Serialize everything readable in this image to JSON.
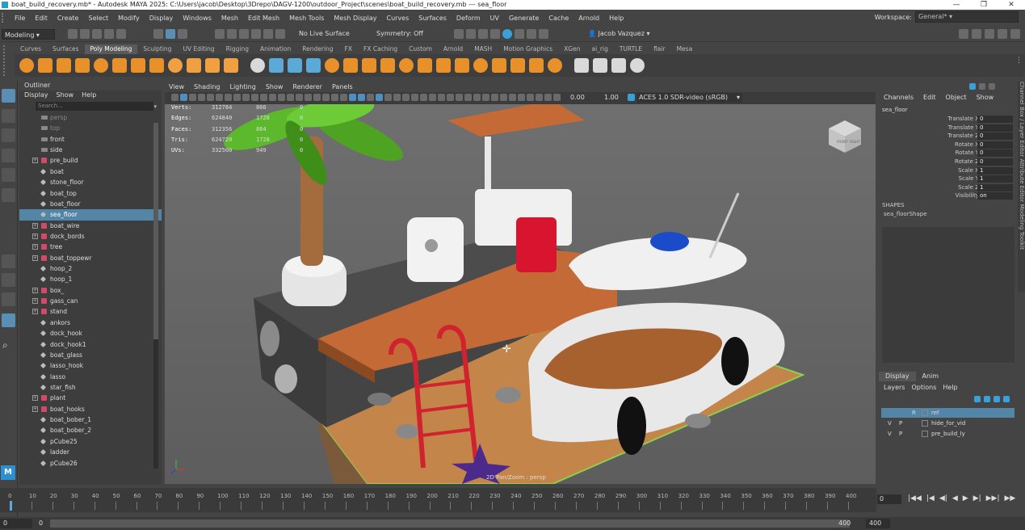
{
  "window": {
    "title": "boat_build_recovery.mb* - Autodesk MAYA 2025: C:\\Users\\jacob\\Desktop\\3Drepo\\DAGV-1200\\outdoor_Project\\scenes\\boat_build_recovery.mb   ---   sea_floor",
    "controls": [
      "—",
      "❐",
      "✕"
    ]
  },
  "menubar": {
    "items": [
      "File",
      "Edit",
      "Create",
      "Select",
      "Modify",
      "Display",
      "Windows",
      "Mesh",
      "Edit Mesh",
      "Mesh Tools",
      "Mesh Display",
      "Curves",
      "Surfaces",
      "Deform",
      "UV",
      "Generate",
      "Cache",
      "Arnold",
      "Help"
    ],
    "workspace_label": "Workspace:",
    "workspace_value": "General*"
  },
  "statusline": {
    "mode": "Modeling",
    "live_surface": "No Live Surface",
    "symmetry": "Symmetry: Off",
    "user": "Jacob Vazquez"
  },
  "shelf": {
    "tabs": [
      "Curves",
      "Surfaces",
      "Poly Modeling",
      "Sculpting",
      "UV Editing",
      "Rigging",
      "Animation",
      "Rendering",
      "FX",
      "FX Caching",
      "Custom",
      "Arnold",
      "MASH",
      "Motion Graphics",
      "XGen",
      "ai_rig",
      "TURTLE",
      "flair",
      "Mesa"
    ],
    "active_tab": "Poly Modeling",
    "icon_colors": [
      "#e8912a",
      "#e8912a",
      "#e8912a",
      "#e8912a",
      "#e8912a",
      "#e8912a",
      "#e8912a",
      "#e8912a",
      "#f0a040",
      "#f0a040",
      "#f0a040",
      "#f0a040",
      "#d9d9d9",
      "#5aa9d6",
      "#5aa9d6",
      "#5aa9d6",
      "#e8912a",
      "#e8912a",
      "#e8912a",
      "#e8912a",
      "#e8912a",
      "#e8912a",
      "#e8912a",
      "#e8912a",
      "#e8912a",
      "#e8912a",
      "#e8912a",
      "#e8912a",
      "#e8912a",
      "#d9d9d9",
      "#d9d9d9",
      "#d9d9d9",
      "#d9d9d9"
    ]
  },
  "outliner": {
    "title": "Outliner",
    "menus": [
      "Display",
      "Show",
      "Help"
    ],
    "search_placeholder": "Search...",
    "items": [
      {
        "label": "persp",
        "type": "cam",
        "dim": true
      },
      {
        "label": "top",
        "type": "cam",
        "dim": true
      },
      {
        "label": "front",
        "type": "cam"
      },
      {
        "label": "side",
        "type": "cam"
      },
      {
        "label": "pre_build",
        "type": "grp",
        "expand": true
      },
      {
        "label": "boat",
        "type": "mesh"
      },
      {
        "label": "stone_floor",
        "type": "mesh"
      },
      {
        "label": "boat_top",
        "type": "mesh"
      },
      {
        "label": "boat_floor",
        "type": "mesh"
      },
      {
        "label": "sea_floor",
        "type": "mesh",
        "selected": true
      },
      {
        "label": "boat_wire",
        "type": "grp",
        "expand": true
      },
      {
        "label": "dock_bords",
        "type": "grp",
        "expand": true
      },
      {
        "label": "tree",
        "type": "grp",
        "expand": true
      },
      {
        "label": "boat_toppewr",
        "type": "grp",
        "expand": true
      },
      {
        "label": "hoop_2",
        "type": "mesh"
      },
      {
        "label": "hoop_1",
        "type": "mesh"
      },
      {
        "label": "box_",
        "type": "grp",
        "expand": true
      },
      {
        "label": "gass_can",
        "type": "grp",
        "expand": true
      },
      {
        "label": "stand",
        "type": "grp",
        "expand": true
      },
      {
        "label": "ankors",
        "type": "mesh"
      },
      {
        "label": "dock_hook",
        "type": "mesh"
      },
      {
        "label": "dock_hook1",
        "type": "mesh"
      },
      {
        "label": "boat_glass",
        "type": "mesh"
      },
      {
        "label": "lasso_hook",
        "type": "mesh"
      },
      {
        "label": "lasso",
        "type": "mesh"
      },
      {
        "label": "star_fish",
        "type": "mesh"
      },
      {
        "label": "plant",
        "type": "grp",
        "expand": true
      },
      {
        "label": "boat_hooks",
        "type": "grp",
        "expand": true
      },
      {
        "label": "boat_bober_1",
        "type": "mesh"
      },
      {
        "label": "boat_bober_2",
        "type": "mesh"
      },
      {
        "label": "pCube25",
        "type": "mesh"
      },
      {
        "label": "ladder",
        "type": "mesh"
      },
      {
        "label": "pCube26",
        "type": "mesh"
      }
    ]
  },
  "viewport": {
    "menus": [
      "View",
      "Shading",
      "Lighting",
      "Show",
      "Renderer",
      "Panels"
    ],
    "field_a": "0.00",
    "field_b": "1.00",
    "colorspace": "ACES 1.0 SDR-video (sRGB)",
    "camera_label": "2D Pan/Zoom : persp",
    "hud": [
      {
        "label": "Verts:",
        "a": "312784",
        "b": "866",
        "c": "0"
      },
      {
        "label": "Edges:",
        "a": "624840",
        "b": "1728",
        "c": "0"
      },
      {
        "label": "Faces:",
        "a": "312356",
        "b": "864",
        "c": "0"
      },
      {
        "label": "Tris:",
        "a": "624720",
        "b": "1728",
        "c": "0"
      },
      {
        "label": "UVs:",
        "a": "332500",
        "b": "949",
        "c": "0"
      }
    ],
    "viewcube_faces": [
      "FRONT",
      "RIGHT"
    ]
  },
  "channelbox": {
    "menus": [
      "Channels",
      "Edit",
      "Object",
      "Show"
    ],
    "object": "sea_floor",
    "channels": [
      {
        "name": "Translate X",
        "value": "0"
      },
      {
        "name": "Translate Y",
        "value": "0"
      },
      {
        "name": "Translate Z",
        "value": "0"
      },
      {
        "name": "Rotate X",
        "value": "0"
      },
      {
        "name": "Rotate Y",
        "value": "0"
      },
      {
        "name": "Rotate Z",
        "value": "0"
      },
      {
        "name": "Scale X",
        "value": "1"
      },
      {
        "name": "Scale Y",
        "value": "1"
      },
      {
        "name": "Scale Z",
        "value": "1"
      },
      {
        "name": "Visibility",
        "value": "on"
      }
    ],
    "shapes_label": "SHAPES",
    "shape_name": "sea_floorShape",
    "side_tabs": "Channel Box / Layer Editor    Attribute Editor    Modeling Toolkit"
  },
  "layers": {
    "tabs": [
      "Display",
      "Anim"
    ],
    "active_tab": "Display",
    "menus": [
      "Layers",
      "Options",
      "Help"
    ],
    "rows": [
      {
        "v": "",
        "p": "",
        "r": "R",
        "name": "ref",
        "selected": true
      },
      {
        "v": "V",
        "p": "P",
        "r": "",
        "name": "hide_for_vid"
      },
      {
        "v": "V",
        "p": "P",
        "r": "",
        "name": "pre_build_ly"
      }
    ]
  },
  "timeline": {
    "ticks": [
      "0",
      "10",
      "20",
      "30",
      "40",
      "50",
      "60",
      "70",
      "80",
      "90",
      "100",
      "110",
      "120",
      "130",
      "140",
      "150",
      "160",
      "170",
      "180",
      "190",
      "200",
      "210",
      "220",
      "230",
      "240",
      "250",
      "260",
      "270",
      "280",
      "290",
      "300",
      "310",
      "320",
      "330",
      "340",
      "350",
      "360",
      "370",
      "380",
      "390",
      "400"
    ],
    "current_frame": "0",
    "range_start": "0",
    "range_inner_start": "0",
    "range_inner_end": "400",
    "range_end": "400",
    "play_buttons": [
      "|◀◀",
      "|◀",
      "◀|",
      "◀",
      "▶",
      "▶|",
      "▶▶|",
      "▶▶"
    ]
  }
}
